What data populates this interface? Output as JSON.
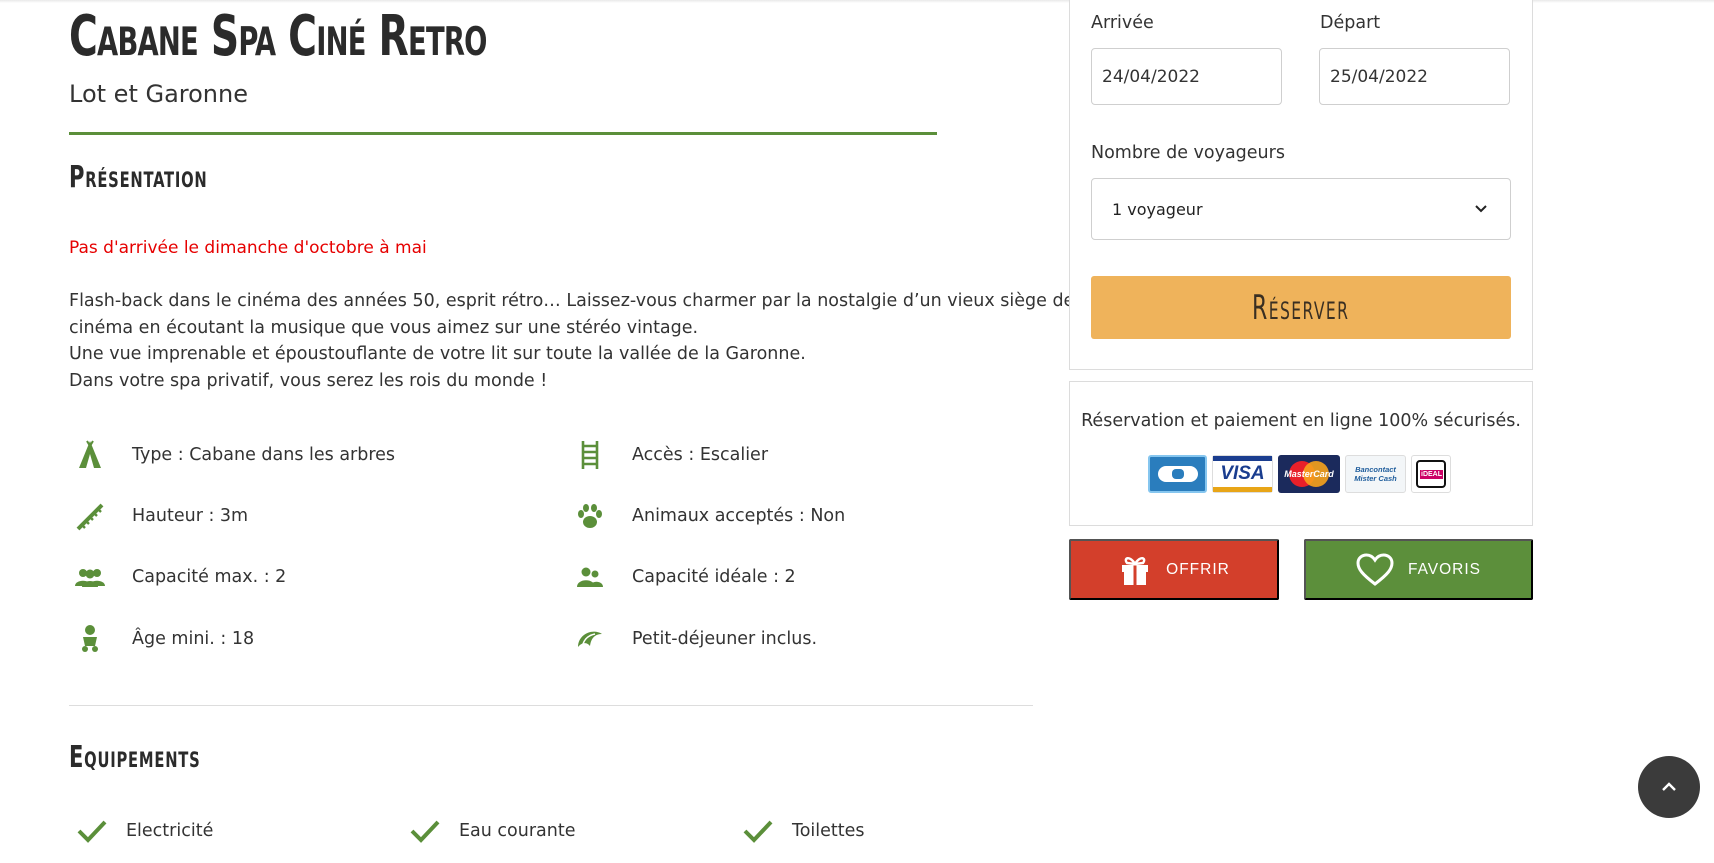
{
  "listing": {
    "title": "Cabane Spa Ciné Retro",
    "location": "Lot et Garonne"
  },
  "presentation": {
    "heading": "Présentation",
    "warning": "Pas d'arrivée le dimanche d'octobre à mai",
    "description": [
      "Flash-back dans le cinéma des années 50, esprit rétro… Laissez-vous charmer par la nostalgie d’un vieux siège de",
      "cinéma en écoutant la musique que vous aimez sur une stéréo vintage.",
      "Une vue imprenable et époustouflante de votre lit sur toute la vallée de la Garonne.",
      "Dans votre spa privatif, vous serez les rois du monde !"
    ],
    "features": [
      {
        "icon": "tent-icon",
        "label": "Type : Cabane dans les arbres"
      },
      {
        "icon": "ladder-icon",
        "label": "Accès : Escalier"
      },
      {
        "icon": "stairs-icon",
        "label": "Hauteur : 3m"
      },
      {
        "icon": "paw-icon",
        "label": "Animaux acceptés : Non"
      },
      {
        "icon": "group-icon",
        "label": "Capacité max. : 2"
      },
      {
        "icon": "couple-icon",
        "label": "Capacité idéale : 2"
      },
      {
        "icon": "baby-icon",
        "label": "Âge mini. : 18"
      },
      {
        "icon": "croissant-icon",
        "label": "Petit-déjeuner inclus."
      }
    ]
  },
  "equipment": {
    "heading": "Equipements",
    "items": [
      "Electricité",
      "Eau courante",
      "Toilettes"
    ]
  },
  "booking": {
    "arrival_label": "Arrivée",
    "arrival_value": "24/04/2022",
    "departure_label": "Départ",
    "departure_value": "25/04/2022",
    "travelers_label": "Nombre de voyageurs",
    "travelers_value": "1 voyageur",
    "reserve_label": "Réserver"
  },
  "payment": {
    "secure_text": "Réservation et paiement en ligne 100% sécurisés.",
    "cards": [
      "CB",
      "VISA",
      "MasterCard",
      "Bancontact Mister Cash",
      "iDEAL"
    ]
  },
  "actions": {
    "offer_label": "OFFRIR",
    "favorites_label": "FAVORIS"
  },
  "colors": {
    "brand_green": "#5b8f3a",
    "warning_red": "#e60000",
    "reserve_orange": "#efb35b",
    "offer_red": "#d33f2b"
  }
}
